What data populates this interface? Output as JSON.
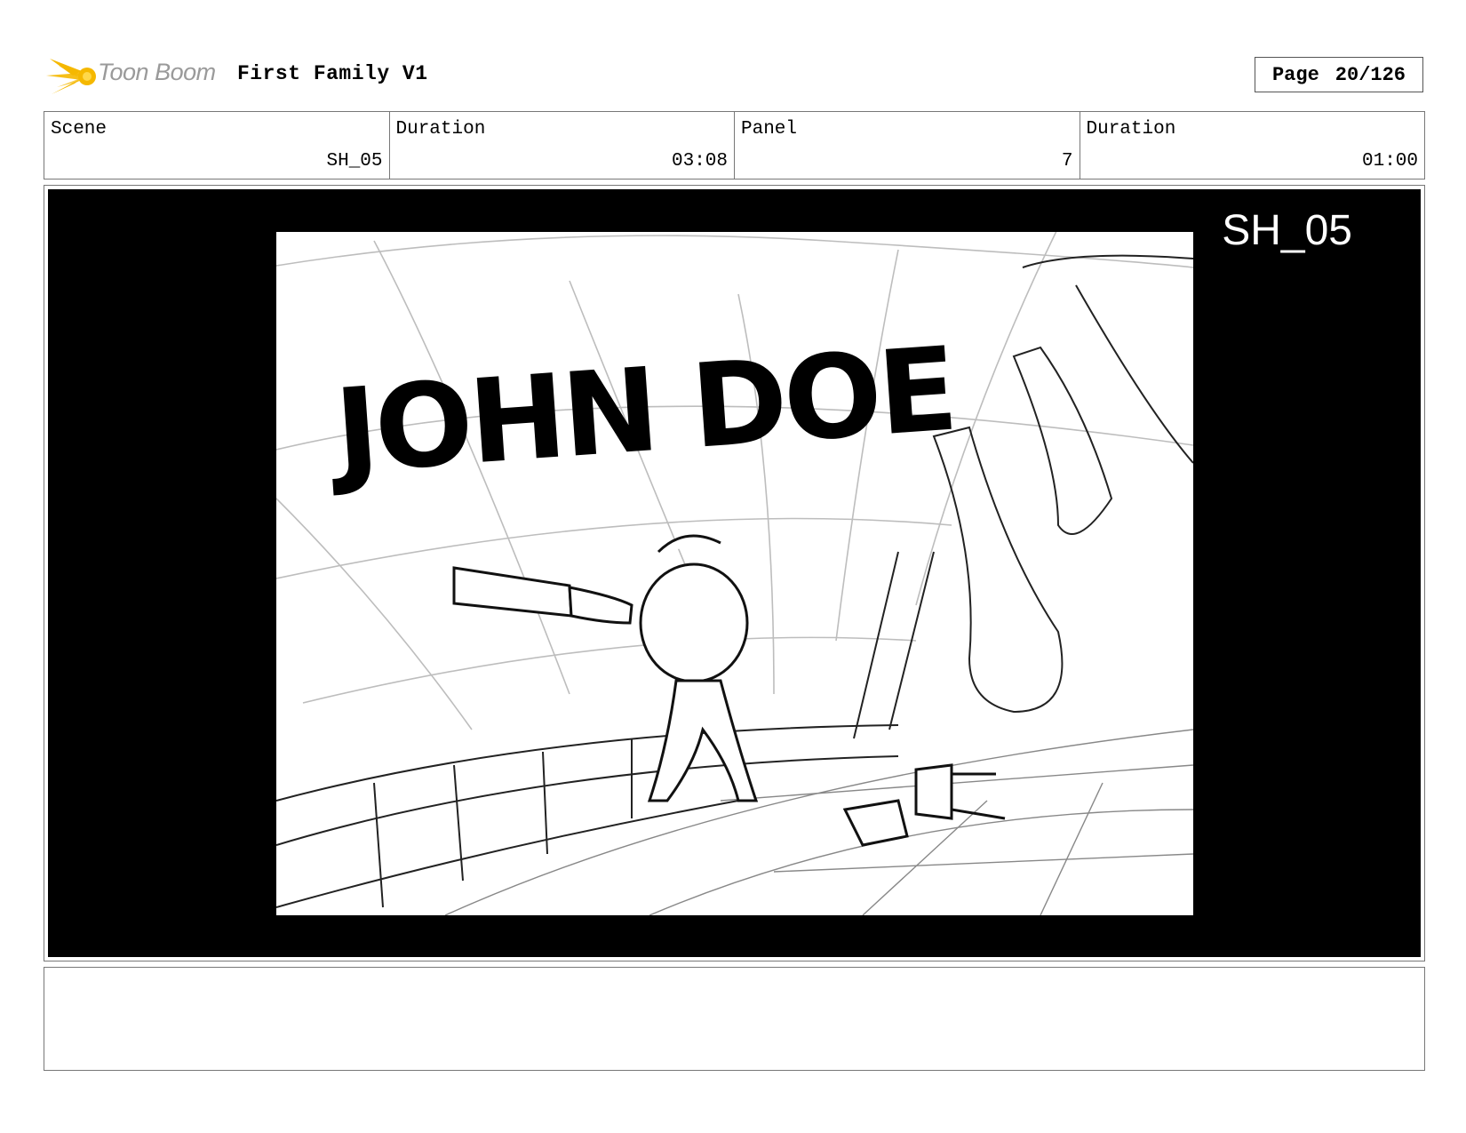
{
  "header": {
    "logo_text": "Toon Boom",
    "title": "First Family V1",
    "page_label": "Page",
    "page_value": "20/126"
  },
  "info": [
    {
      "label": "Scene",
      "value": "SH_05"
    },
    {
      "label": "Duration",
      "value": "03:08"
    },
    {
      "label": "Panel",
      "value": "7"
    },
    {
      "label": "Duration",
      "value": "01:00"
    }
  ],
  "panel": {
    "overlay_label": "SH_05",
    "sign_text": "JOHN DOE"
  },
  "icons": {
    "logo": "toon-boom-star-icon"
  },
  "colors": {
    "logo_star": "#f5b800",
    "logo_text": "#9a9a9a",
    "panel_background": "#000000"
  },
  "notes": ""
}
